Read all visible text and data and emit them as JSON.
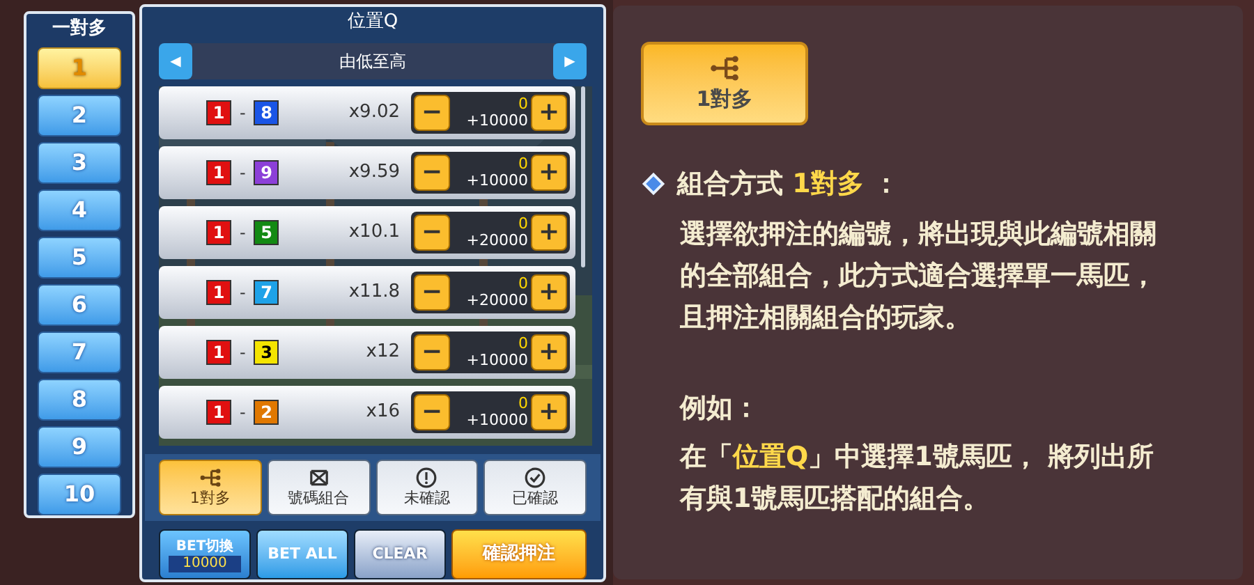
{
  "sidebar": {
    "title": "一對多",
    "items": [
      {
        "label": "1",
        "selected": true
      },
      {
        "label": "2",
        "selected": false
      },
      {
        "label": "3",
        "selected": false
      },
      {
        "label": "4",
        "selected": false
      },
      {
        "label": "5",
        "selected": false
      },
      {
        "label": "6",
        "selected": false
      },
      {
        "label": "7",
        "selected": false
      },
      {
        "label": "8",
        "selected": false
      },
      {
        "label": "9",
        "selected": false
      },
      {
        "label": "10",
        "selected": false
      }
    ]
  },
  "panel": {
    "title": "位置Q",
    "sort": {
      "prev": "◀",
      "label": "由低至高",
      "next": "▶"
    },
    "rows": [
      {
        "first": {
          "number": "1",
          "color": "#e01010"
        },
        "dash": "-",
        "second": {
          "number": "8",
          "color": "#1a55e6"
        },
        "odds": "x9.02",
        "minus": "−",
        "amount": "0",
        "step": "+10000",
        "plus": "+"
      },
      {
        "first": {
          "number": "1",
          "color": "#e01010"
        },
        "dash": "-",
        "second": {
          "number": "9",
          "color": "#8c3fd8"
        },
        "odds": "x9.59",
        "minus": "−",
        "amount": "0",
        "step": "+10000",
        "plus": "+"
      },
      {
        "first": {
          "number": "1",
          "color": "#e01010"
        },
        "dash": "-",
        "second": {
          "number": "5",
          "color": "#138a13"
        },
        "odds": "x10.1",
        "minus": "−",
        "amount": "0",
        "step": "+20000",
        "plus": "+"
      },
      {
        "first": {
          "number": "1",
          "color": "#e01010"
        },
        "dash": "-",
        "second": {
          "number": "7",
          "color": "#1ea2e8"
        },
        "odds": "x11.8",
        "minus": "−",
        "amount": "0",
        "step": "+20000",
        "plus": "+"
      },
      {
        "first": {
          "number": "1",
          "color": "#e01010"
        },
        "dash": "-",
        "second": {
          "number": "3",
          "color": "#f4e400"
        },
        "odds": "x12",
        "minus": "−",
        "amount": "0",
        "step": "+10000",
        "plus": "+"
      },
      {
        "first": {
          "number": "1",
          "color": "#e01010"
        },
        "dash": "-",
        "second": {
          "number": "2",
          "color": "#e07800"
        },
        "odds": "x16",
        "minus": "−",
        "amount": "0",
        "step": "+10000",
        "plus": "+"
      }
    ],
    "modes": [
      {
        "kind": "tree",
        "label": "1對多",
        "selected": true
      },
      {
        "kind": "cross",
        "label": "號碼組合",
        "selected": false
      },
      {
        "kind": "alert",
        "label": "未確認",
        "selected": false
      },
      {
        "kind": "check",
        "label": "已確認",
        "selected": false
      }
    ],
    "actions": [
      {
        "kind": "switch",
        "label": "BET切換",
        "value": "10000"
      },
      {
        "kind": "blue",
        "label": "BET ALL"
      },
      {
        "kind": "light",
        "label": "CLEAR"
      },
      {
        "kind": "confirm",
        "label": "確認押注"
      }
    ]
  },
  "help": {
    "mode_badge": {
      "label": "1對多"
    },
    "heading": [
      {
        "text": "組合方式 ",
        "highlight": false
      },
      {
        "text": "1對多",
        "highlight": true
      },
      {
        "text": " ：",
        "highlight": false
      }
    ],
    "description": "選擇欲押注的編號，將出現與此編號相關的全部組合，此方式適合選擇單一馬匹，且押注相關組合的玩家。",
    "example_label": "例如：",
    "example": [
      {
        "text": "在「",
        "highlight": false
      },
      {
        "text": "位置Q",
        "highlight": true
      },
      {
        "text": "」中選擇1號馬匹， 將列出所有與1號馬匹搭配的組合。",
        "highlight": false
      }
    ]
  }
}
